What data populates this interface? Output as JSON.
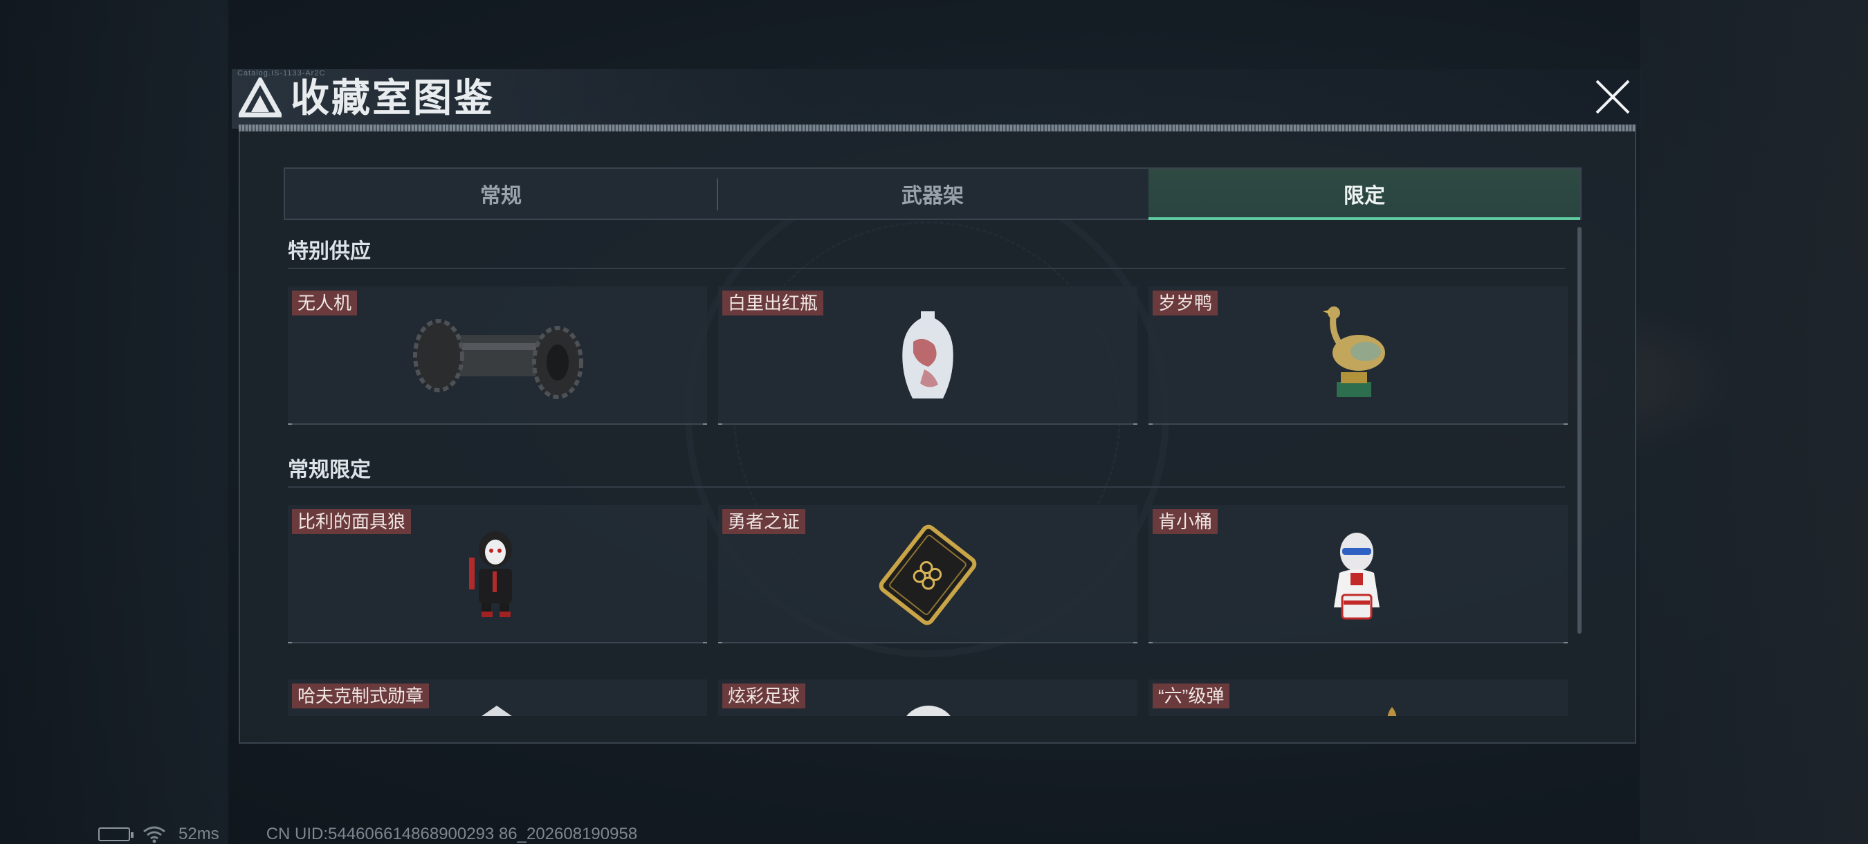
{
  "window": {
    "title": "收藏室图鉴",
    "title_tiny": "Catalog.IS-1133-Ar2C",
    "close_icon": "close-x-icon"
  },
  "tabs": [
    {
      "label": "常规",
      "active": false
    },
    {
      "label": "武器架",
      "active": false
    },
    {
      "label": "限定",
      "active": true
    }
  ],
  "sections": [
    {
      "title": "特别供应",
      "items": [
        {
          "label": "无人机",
          "icon": "tire-roller-icon"
        },
        {
          "label": "白里出红瓶",
          "icon": "porcelain-vase-icon"
        },
        {
          "label": "岁岁鸭",
          "icon": "duck-statue-icon"
        }
      ]
    },
    {
      "title": "常规限定",
      "items": [
        {
          "label": "比利的面具狼",
          "icon": "puppet-figure-icon"
        },
        {
          "label": "勇者之证",
          "icon": "gold-card-icon"
        },
        {
          "label": "肯小桶",
          "icon": "colonel-bust-icon"
        },
        {
          "label": "哈夫克制式勋章",
          "icon": "medal-icon"
        },
        {
          "label": "炫彩足球",
          "icon": "football-icon"
        },
        {
          "label": "“六”级弹",
          "icon": "bullet-icon"
        }
      ]
    }
  ],
  "status_bar": {
    "ping": "52ms",
    "uid": "CN UID:544606614868900293 86_202608190958",
    "battery_icon": "battery-charging-icon",
    "wifi_icon": "wifi-icon"
  },
  "colors": {
    "accent": "#5fc9a0",
    "label_bg": "#6a3a3c",
    "panel_bg": "#1c242c"
  }
}
